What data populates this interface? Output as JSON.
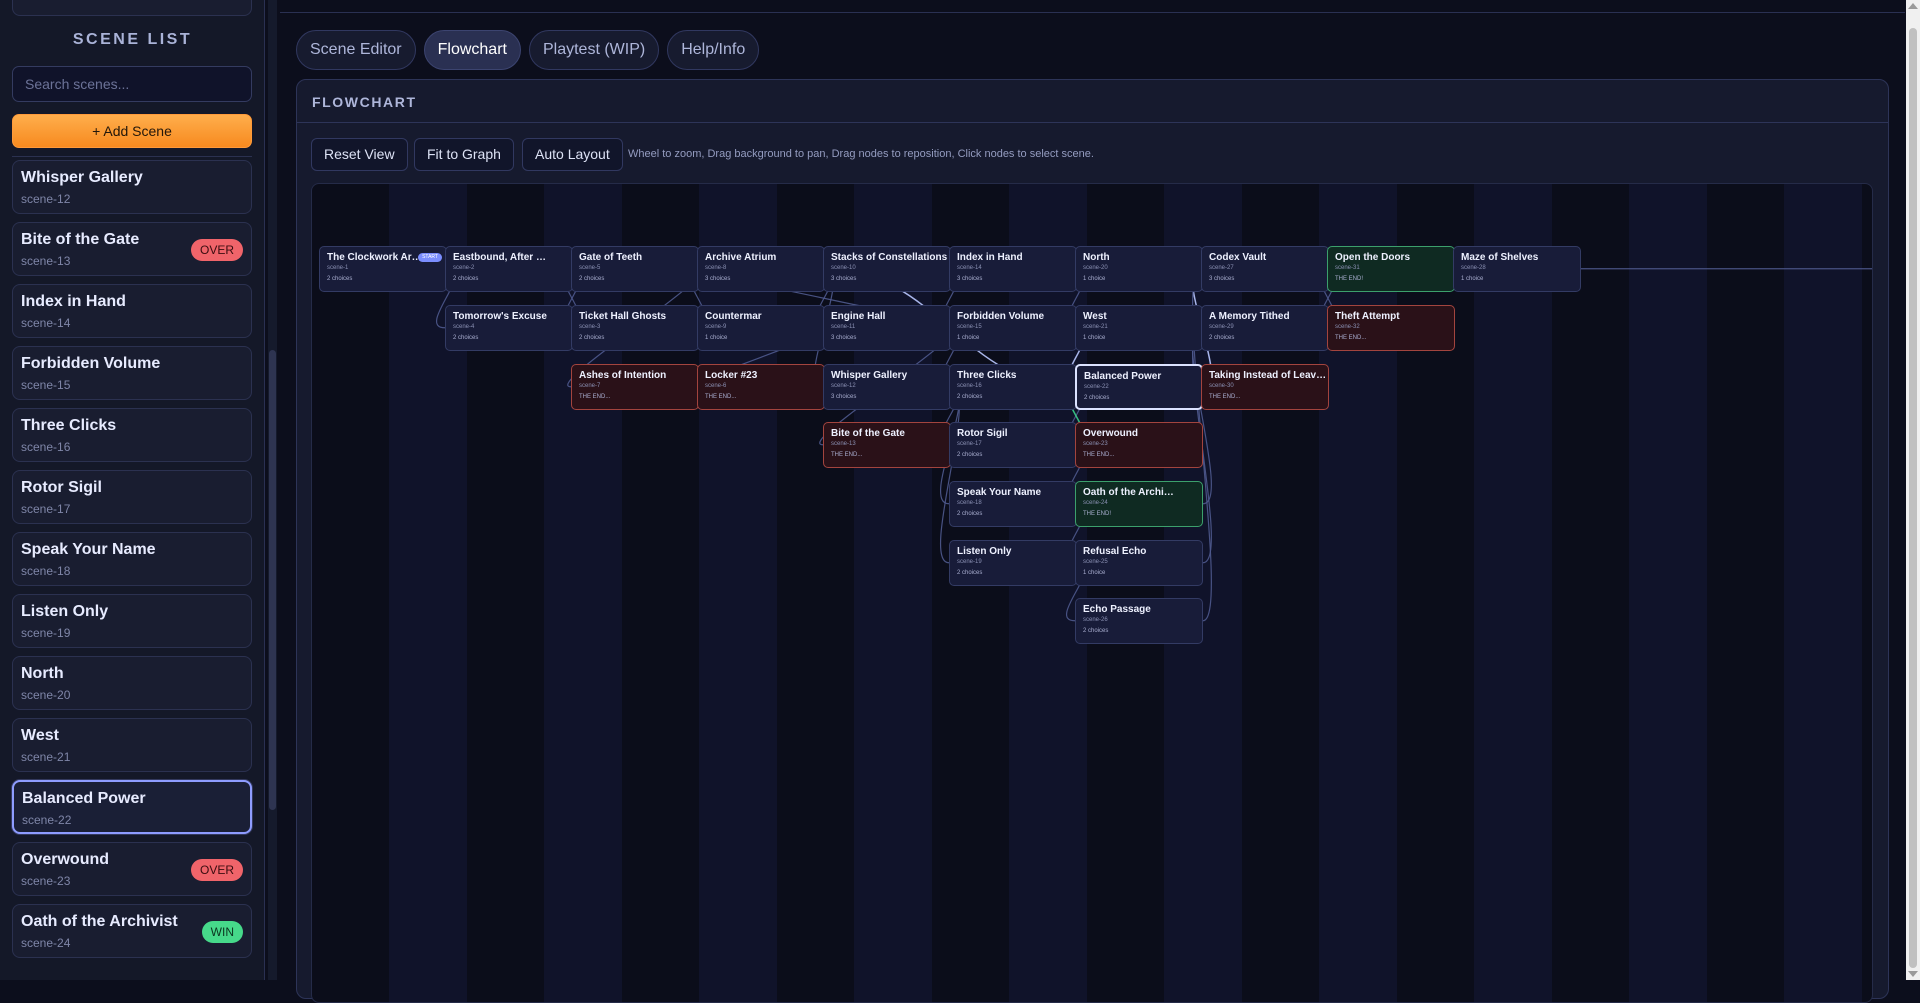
{
  "sidebar": {
    "title": "SCENE LIST",
    "search_placeholder": "Search scenes...",
    "add_button": "+ Add Scene",
    "scenes": [
      {
        "name": "Whisper Gallery",
        "id": "scene-12",
        "badge": ""
      },
      {
        "name": "Bite of the Gate",
        "id": "scene-13",
        "badge": "OVER"
      },
      {
        "name": "Index in Hand",
        "id": "scene-14",
        "badge": ""
      },
      {
        "name": "Forbidden Volume",
        "id": "scene-15",
        "badge": ""
      },
      {
        "name": "Three Clicks",
        "id": "scene-16",
        "badge": ""
      },
      {
        "name": "Rotor Sigil",
        "id": "scene-17",
        "badge": ""
      },
      {
        "name": "Speak Your Name",
        "id": "scene-18",
        "badge": ""
      },
      {
        "name": "Listen Only",
        "id": "scene-19",
        "badge": ""
      },
      {
        "name": "North",
        "id": "scene-20",
        "badge": ""
      },
      {
        "name": "West",
        "id": "scene-21",
        "badge": ""
      },
      {
        "name": "Balanced Power",
        "id": "scene-22",
        "badge": "",
        "selected": true
      },
      {
        "name": "Overwound",
        "id": "scene-23",
        "badge": "OVER"
      },
      {
        "name": "Oath of the Archivist",
        "id": "scene-24",
        "badge": "WIN"
      }
    ]
  },
  "tabs": [
    {
      "label": "Scene Editor",
      "active": false
    },
    {
      "label": "Flowchart",
      "active": true
    },
    {
      "label": "Playtest (WIP)",
      "active": false
    },
    {
      "label": "Help/Info",
      "active": false
    }
  ],
  "flowchart": {
    "title": "FLOWCHART",
    "buttons": {
      "reset": "Reset View",
      "fit": "Fit to Graph",
      "auto": "Auto Layout"
    },
    "hint": "Wheel to zoom, Drag background to pan, Drag nodes to reposition, Click nodes to select scene.",
    "start_label": "START",
    "nodes": [
      {
        "key": "n1",
        "name": "The Clockwork Arc...",
        "id": "scene-1",
        "meta": "2 choices",
        "type": "start"
      },
      {
        "key": "n2",
        "name": "Eastbound, After Hours",
        "id": "scene-2",
        "meta": "2 choices",
        "type": "normal"
      },
      {
        "key": "n4",
        "name": "Tomorrow's Excuse",
        "id": "scene-4",
        "meta": "2 choices",
        "type": "normal"
      },
      {
        "key": "n5",
        "name": "Gate of Teeth",
        "id": "scene-5",
        "meta": "2 choices",
        "type": "normal"
      },
      {
        "key": "n3",
        "name": "Ticket Hall Ghosts",
        "id": "scene-3",
        "meta": "2 choices",
        "type": "normal"
      },
      {
        "key": "n7",
        "name": "Ashes of Intention",
        "id": "scene-7",
        "meta": "THE END...",
        "type": "bad"
      },
      {
        "key": "n8",
        "name": "Archive Atrium",
        "id": "scene-8",
        "meta": "3 choices",
        "type": "normal"
      },
      {
        "key": "n9",
        "name": "Countermar",
        "id": "scene-9",
        "meta": "1 choice",
        "type": "normal"
      },
      {
        "key": "n6",
        "name": "Locker #23",
        "id": "scene-6",
        "meta": "THE END...",
        "type": "bad"
      },
      {
        "key": "n10",
        "name": "Stacks of Constellations",
        "id": "scene-10",
        "meta": "3 choices",
        "type": "normal"
      },
      {
        "key": "n11",
        "name": "Engine Hall",
        "id": "scene-11",
        "meta": "3 choices",
        "type": "normal"
      },
      {
        "key": "n12",
        "name": "Whisper Gallery",
        "id": "scene-12",
        "meta": "3 choices",
        "type": "normal"
      },
      {
        "key": "n13",
        "name": "Bite of the Gate",
        "id": "scene-13",
        "meta": "THE END...",
        "type": "bad"
      },
      {
        "key": "n14",
        "name": "Index in Hand",
        "id": "scene-14",
        "meta": "3 choices",
        "type": "normal"
      },
      {
        "key": "n15",
        "name": "Forbidden Volume",
        "id": "scene-15",
        "meta": "1 choice",
        "type": "normal"
      },
      {
        "key": "n16",
        "name": "Three Clicks",
        "id": "scene-16",
        "meta": "2 choices",
        "type": "normal"
      },
      {
        "key": "n17",
        "name": "Rotor Sigil",
        "id": "scene-17",
        "meta": "2 choices",
        "type": "normal"
      },
      {
        "key": "n18",
        "name": "Speak Your Name",
        "id": "scene-18",
        "meta": "2 choices",
        "type": "normal"
      },
      {
        "key": "n19",
        "name": "Listen Only",
        "id": "scene-19",
        "meta": "2 choices",
        "type": "normal"
      },
      {
        "key": "n20",
        "name": "North",
        "id": "scene-20",
        "meta": "1 choice",
        "type": "normal"
      },
      {
        "key": "n21",
        "name": "West",
        "id": "scene-21",
        "meta": "1 choice",
        "type": "normal"
      },
      {
        "key": "n22",
        "name": "Balanced Power",
        "id": "scene-22",
        "meta": "2 choices",
        "type": "selected"
      },
      {
        "key": "n23",
        "name": "Overwound",
        "id": "scene-23",
        "meta": "THE END...",
        "type": "bad"
      },
      {
        "key": "n24",
        "name": "Oath of the Archivist",
        "id": "scene-24",
        "meta": "THE END!",
        "type": "good"
      },
      {
        "key": "n25",
        "name": "Refusal Echo",
        "id": "scene-25",
        "meta": "1 choice",
        "type": "normal"
      },
      {
        "key": "n26",
        "name": "Echo Passage",
        "id": "scene-26",
        "meta": "2 choices",
        "type": "normal"
      },
      {
        "key": "n27",
        "name": "Codex Vault",
        "id": "scene-27",
        "meta": "3 choices",
        "type": "normal"
      },
      {
        "key": "n29",
        "name": "A Memory Tithed",
        "id": "scene-29",
        "meta": "2 choices",
        "type": "normal"
      },
      {
        "key": "n30",
        "name": "Taking Instead of Leaving",
        "id": "scene-30",
        "meta": "THE END...",
        "type": "bad"
      },
      {
        "key": "n31",
        "name": "Open the Doors",
        "id": "scene-31",
        "meta": "THE END!",
        "type": "good"
      },
      {
        "key": "n32",
        "name": "Theft Attempt",
        "id": "scene-32",
        "meta": "THE END...",
        "type": "bad"
      },
      {
        "key": "n28",
        "name": "Maze of Shelves",
        "id": "scene-28",
        "meta": "1 choice",
        "type": "normal"
      }
    ],
    "edges": [
      [
        "n1",
        "n2"
      ],
      [
        "n1",
        "n4"
      ],
      [
        "n2",
        "n5"
      ],
      [
        "n2",
        "n3"
      ],
      [
        "n4",
        "n5"
      ],
      [
        "n4",
        "n3"
      ],
      [
        "n5",
        "n8"
      ],
      [
        "n5",
        "n7"
      ],
      [
        "n3",
        "n8"
      ],
      [
        "n3",
        "n9"
      ],
      [
        "n8",
        "n10"
      ],
      [
        "n8",
        "n11"
      ],
      [
        "n8",
        "n12"
      ],
      [
        "n9",
        "n6"
      ],
      [
        "n9",
        "n11"
      ],
      [
        "n10",
        "n14"
      ],
      [
        "n10",
        "n15"
      ],
      [
        "n11",
        "n15"
      ],
      [
        "n11",
        "n16"
      ],
      [
        "n12",
        "n16"
      ],
      [
        "n12",
        "n17"
      ],
      [
        "n11",
        "n13"
      ],
      [
        "n14",
        "n20"
      ],
      [
        "n14",
        "n21"
      ],
      [
        "n15",
        "n22"
      ],
      [
        "n16",
        "n22"
      ],
      [
        "n16",
        "n23"
      ],
      [
        "n17",
        "n22"
      ],
      [
        "n17",
        "n24"
      ],
      [
        "n18",
        "n24"
      ],
      [
        "n18",
        "n25"
      ],
      [
        "n19",
        "n25"
      ],
      [
        "n19",
        "n26"
      ],
      [
        "n20",
        "n27"
      ],
      [
        "n21",
        "n29"
      ],
      [
        "n22",
        "n27"
      ],
      [
        "n22",
        "n30"
      ],
      [
        "n24",
        "n29"
      ],
      [
        "n25",
        "n29"
      ],
      [
        "n26",
        "n27"
      ],
      [
        "n27",
        "n31"
      ],
      [
        "n27",
        "n32"
      ],
      [
        "n29",
        "n31"
      ],
      [
        "n29",
        "n32"
      ],
      [
        "n31",
        "n28"
      ],
      [
        "n12",
        "n18"
      ],
      [
        "n12",
        "n19"
      ],
      [
        "n8",
        "n22"
      ],
      [
        "n2",
        "n21"
      ],
      [
        "n28",
        "out"
      ]
    ]
  }
}
